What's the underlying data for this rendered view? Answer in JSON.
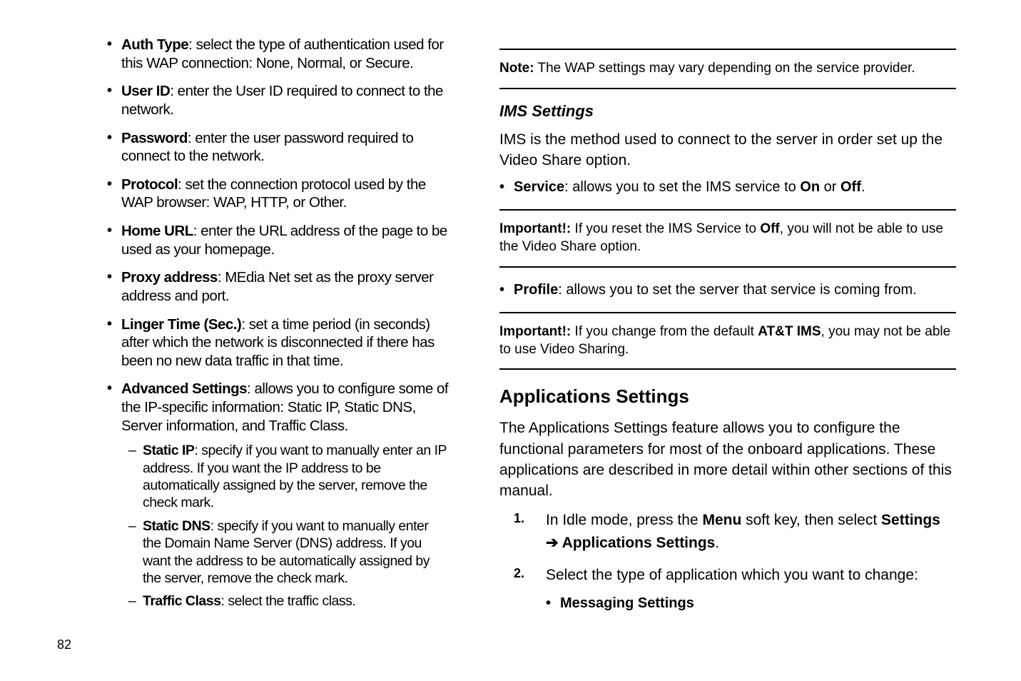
{
  "left": {
    "items": [
      {
        "term": "Auth Type",
        "desc": ": select the type of authentication used for this WAP connection: None, Normal, or Secure."
      },
      {
        "term": "User ID",
        "desc": ": enter the User ID required to connect to the network."
      },
      {
        "term": "Password",
        "desc": ": enter the user password required to connect to the network."
      },
      {
        "term": "Protocol",
        "desc": ": set the connection protocol used by the WAP browser: WAP, HTTP, or Other."
      },
      {
        "term": "Home URL",
        "desc": ": enter the URL address of the page to be used as your homepage."
      },
      {
        "term": "Proxy address",
        "desc": ": MEdia Net set as the proxy server address and port."
      },
      {
        "term": "Linger Time (Sec.)",
        "desc": ": set a time period (in seconds) after which the network is disconnected if there has been no new data traffic in that time."
      },
      {
        "term": "Advanced Settings",
        "desc": ": allows you to configure some of the IP-specific information: Static IP, Static DNS, Server information, and Traffic Class.",
        "subs": [
          {
            "term": "Static IP",
            "desc": ": specify if you want to manually enter an IP address. If you want the IP address to be automatically assigned by the server, remove the check mark."
          },
          {
            "term": "Static DNS",
            "desc": ": specify if you want to manually enter the Domain Name Server (DNS) address. If you want the address to be automatically assigned by the server, remove the check mark."
          },
          {
            "term": "Traffic Class",
            "desc": ": select the traffic class."
          }
        ]
      }
    ]
  },
  "right": {
    "note1": {
      "label": "Note:",
      "text": " The WAP settings may vary depending on the service provider."
    },
    "ims": {
      "heading": "IMS Settings",
      "intro": "IMS is the method used to connect to the server in order set up the Video Share option.",
      "service": {
        "term": "Service",
        "pre": ": allows you to set the IMS service to ",
        "on": "On",
        "mid": " or ",
        "off": "Off",
        "end": "."
      },
      "important1": {
        "label": "Important!:",
        "pre": " If you reset the IMS Service to ",
        "off": "Off",
        "post": ", you will not be able to use the Video Share option."
      },
      "profile": {
        "term": "Profile",
        "desc": ": allows you to set the server that service is coming from."
      },
      "important2": {
        "label": "Important!:",
        "pre": " If you change from the default ",
        "att": "AT&T IMS",
        "post": ", you may not be able to use Video Sharing."
      }
    },
    "apps": {
      "heading": "Applications Settings",
      "intro": "The Applications Settings feature allows you to configure the functional parameters for most of the onboard applications. These applications are described in more detail within other sections of this manual.",
      "steps": [
        {
          "num": "1.",
          "pre": "In Idle mode, press the ",
          "b1": "Menu",
          "mid": " soft key, then select ",
          "b2": "Settings",
          "line2pre": " ",
          "arrow": "➔",
          "line2b": " Applications Settings",
          "end": "."
        },
        {
          "num": "2.",
          "text": "Select the type of application which you want to change:",
          "sub": "Messaging Settings"
        }
      ]
    }
  },
  "pageNumber": "82"
}
